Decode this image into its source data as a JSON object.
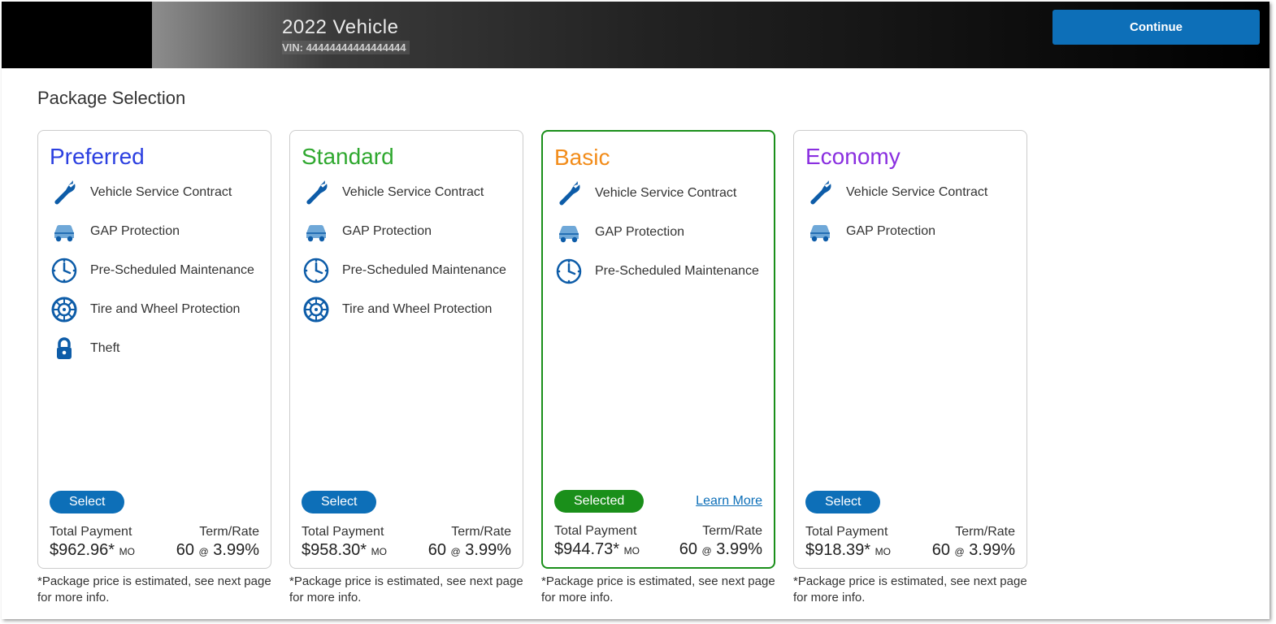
{
  "header": {
    "vehicle_title": "2022 Vehicle",
    "vin_label": "VIN: 44444444444444444",
    "continue_label": "Continue"
  },
  "page_title": "Package Selection",
  "labels": {
    "total_payment": "Total Payment",
    "term_rate": "Term/Rate",
    "select": "Select",
    "selected": "Selected",
    "learn_more": "Learn More"
  },
  "disclaimer": "*Package price is estimated, see next page for more info.",
  "feature_names": {
    "vsc": "Vehicle Service Contract",
    "gap": "GAP Protection",
    "maint": "Pre-Scheduled Maintenance",
    "tire": "Tire and Wheel Protection",
    "theft": "Theft"
  },
  "packages": [
    {
      "id": "preferred",
      "name": "Preferred",
      "color": "#2b3fe0",
      "selected": false,
      "features": [
        "vsc",
        "gap",
        "maint",
        "tire",
        "theft"
      ],
      "payment": "$962.96*",
      "per": "MO",
      "term": "60",
      "rate": "3.99%"
    },
    {
      "id": "standard",
      "name": "Standard",
      "color": "#2fa82f",
      "selected": false,
      "features": [
        "vsc",
        "gap",
        "maint",
        "tire"
      ],
      "payment": "$958.30*",
      "per": "MO",
      "term": "60",
      "rate": "3.99%"
    },
    {
      "id": "basic",
      "name": "Basic",
      "color": "#f28c1a",
      "selected": true,
      "features": [
        "vsc",
        "gap",
        "maint"
      ],
      "payment": "$944.73*",
      "per": "MO",
      "term": "60",
      "rate": "3.99%"
    },
    {
      "id": "economy",
      "name": "Economy",
      "color": "#8a2fe0",
      "selected": false,
      "features": [
        "vsc",
        "gap"
      ],
      "payment": "$918.39*",
      "per": "MO",
      "term": "60",
      "rate": "3.99%"
    }
  ]
}
